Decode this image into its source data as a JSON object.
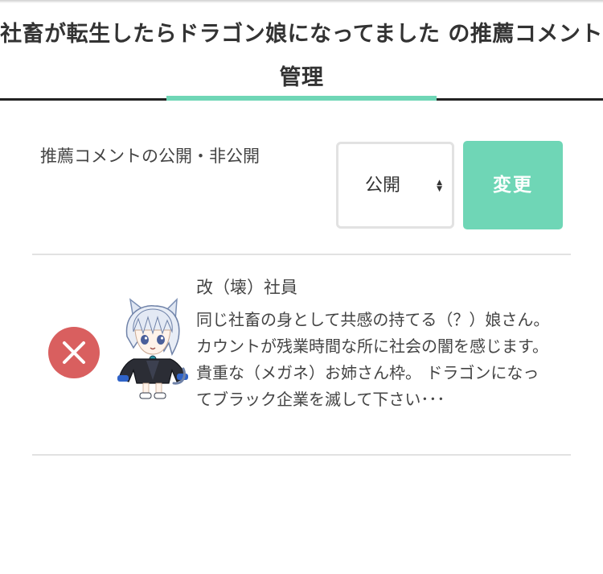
{
  "header": {
    "title": "社畜が転生したらドラゴン娘になってました の推薦コメント管理"
  },
  "settings": {
    "visibility_label": "推薦コメントの公開・非公開",
    "visibility_value": "公開",
    "change_button": "変更"
  },
  "comments": [
    {
      "name": "改（壊）社員",
      "text": "同じ社畜の身として共感の持てる（？）娘さん。 カウントが残業時間な所に社会の闇を感じます。 貴重な（メガネ）お姉さん枠。 ドラゴンになってブラック企業を滅して下さい･･･"
    }
  ],
  "colors": {
    "accent": "#6fd6b6",
    "delete": "#d95f5f",
    "text": "#333333",
    "divider": "#e2e2e2"
  },
  "icons": {
    "delete": "close-icon",
    "select": "chevron-updown-icon"
  }
}
